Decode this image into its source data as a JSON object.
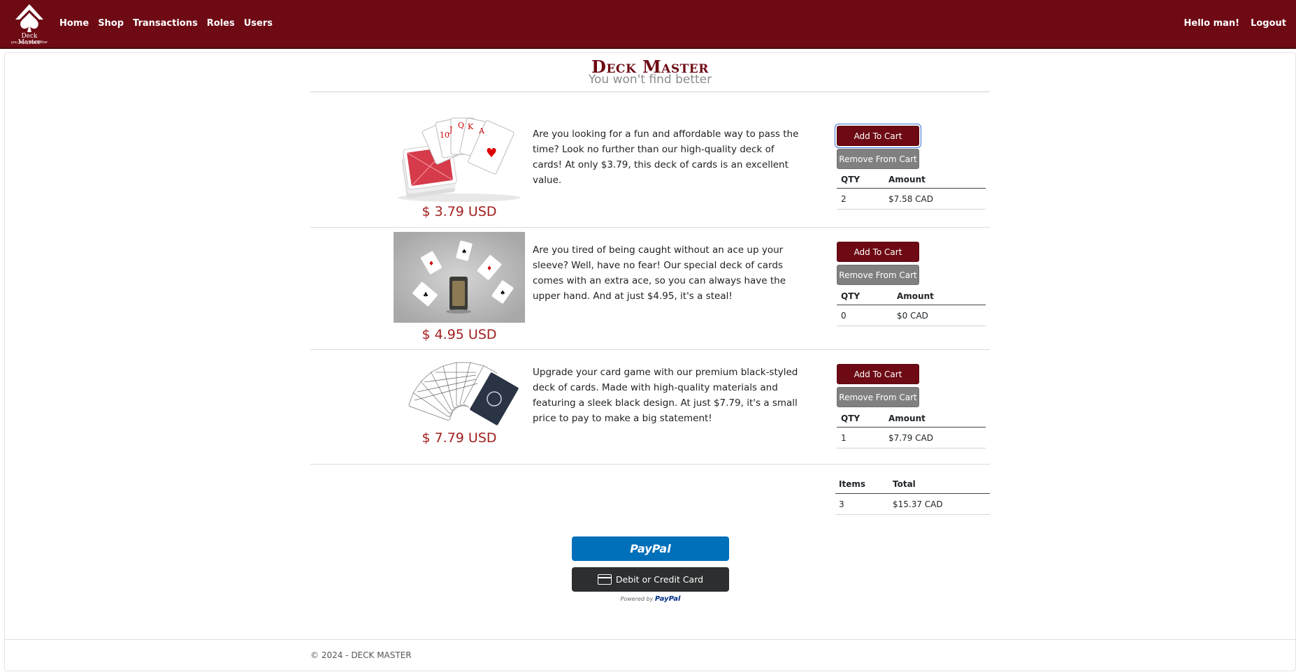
{
  "nav": {
    "logo_text": "Deck Master",
    "logo_tagline": "you won't find better",
    "links": [
      "Home",
      "Shop",
      "Transactions",
      "Roles",
      "Users"
    ],
    "greeting": "Hello man!",
    "logout": "Logout"
  },
  "brand": {
    "title": "Deck Master",
    "subtitle": "You won't find better"
  },
  "products": [
    {
      "price": "$ 3.79 USD",
      "description": "Are you looking for a fun and affordable way to pass the time? Look no further than our high-quality deck of cards! At only $3.79, this deck of cards is an excellent value.",
      "add_label": "Add To Cart",
      "remove_label": "Remove From Cart",
      "qty_header": "QTY",
      "amount_header": "Amount",
      "qty": "2",
      "amount": "$7.58 CAD"
    },
    {
      "price": "$ 4.95 USD",
      "description": "Are you tired of being caught without an ace up your sleeve? Well, have no fear! Our special deck of cards comes with an extra ace, so you can always have the upper hand. And at just $4.95, it's a steal!",
      "add_label": "Add To Cart",
      "remove_label": "Remove From Cart",
      "qty_header": "QTY",
      "amount_header": "Amount",
      "qty": "0",
      "amount": "$0 CAD"
    },
    {
      "price": "$ 7.79 USD",
      "description": "Upgrade your card game with our premium black-styled deck of cards. Made with high-quality materials and featuring a sleek black design. At just $7.79, it's a small price to pay to make a big statement!",
      "add_label": "Add To Cart",
      "remove_label": "Remove From Cart",
      "qty_header": "QTY",
      "amount_header": "Amount",
      "qty": "1",
      "amount": "$7.79 CAD"
    }
  ],
  "totals": {
    "items_header": "Items",
    "total_header": "Total",
    "items": "3",
    "total": "$15.37 CAD"
  },
  "payment": {
    "paypal_label": "PayPal",
    "card_label": "Debit or Credit Card",
    "powered_by": "Powered by",
    "powered_brand": "PayPal"
  },
  "footer": {
    "text": "© 2024 - DECK MASTER"
  },
  "colors": {
    "brand": "#6d0a14",
    "price": "#a32020",
    "remove_button": "#808080",
    "paypal": "#0070ba",
    "card_button": "#2c2e2f"
  }
}
